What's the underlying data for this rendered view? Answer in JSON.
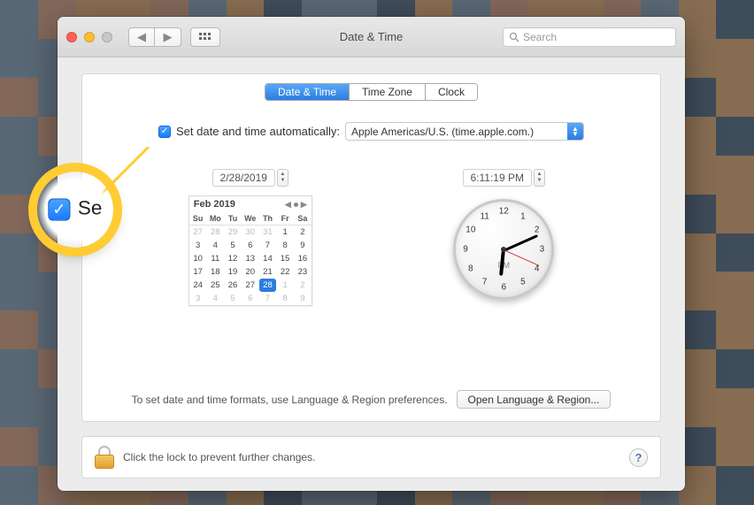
{
  "window": {
    "title": "Date & Time"
  },
  "search": {
    "placeholder": "Search"
  },
  "tabs": {
    "date_time": "Date & Time",
    "time_zone": "Time Zone",
    "clock": "Clock"
  },
  "auto": {
    "label": "Set date and time automatically:",
    "server": "Apple Americas/U.S. (time.apple.com.)"
  },
  "date_field": "2/28/2019",
  "time_field": "6:11:19 PM",
  "calendar": {
    "month_label": "Feb 2019",
    "day_headers": [
      "Su",
      "Mo",
      "Tu",
      "We",
      "Th",
      "Fr",
      "Sa"
    ],
    "leading_dim": [
      "27",
      "28",
      "29",
      "30",
      "31"
    ],
    "days": [
      "1",
      "2",
      "3",
      "4",
      "5",
      "6",
      "7",
      "8",
      "9",
      "10",
      "11",
      "12",
      "13",
      "14",
      "15",
      "16",
      "17",
      "18",
      "19",
      "20",
      "21",
      "22",
      "23",
      "24",
      "25",
      "26",
      "27",
      "28"
    ],
    "trailing_dim": [
      "1",
      "2",
      "3",
      "4",
      "5",
      "6",
      "7",
      "8",
      "9"
    ],
    "today": "28"
  },
  "clock": {
    "ampm": "PM",
    "hour": 6,
    "minute": 11,
    "second": 19
  },
  "footer": {
    "hint": "To set date and time formats, use Language & Region preferences.",
    "button": "Open Language & Region..."
  },
  "lock": {
    "text": "Click the lock to prevent further changes."
  },
  "callout": {
    "text": "Se"
  }
}
